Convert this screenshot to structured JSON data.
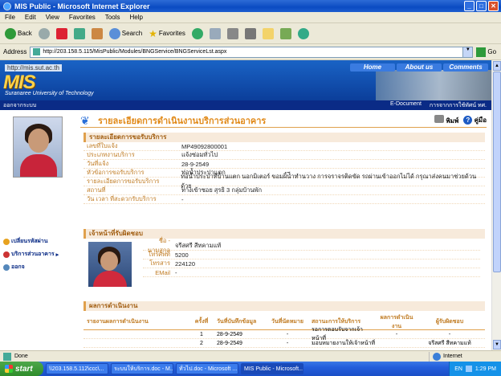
{
  "window": {
    "title": "MIS Public - Microsoft Internet Explorer"
  },
  "menu": [
    "File",
    "Edit",
    "View",
    "Favorites",
    "Tools",
    "Help"
  ],
  "toolbar": {
    "back": "Back",
    "search": "Search",
    "favorites": "Favorites"
  },
  "address": {
    "label": "Address",
    "url": "http://203.158.5.115/MisPublic/Modules/BNGService/BNGServiceLst.aspx",
    "go": "Go"
  },
  "header": {
    "site_url": "http://mis.sut.ac.th",
    "logo": "MIS",
    "subtitle": "Suranaree University of Technology",
    "nav": [
      "Home",
      "About us",
      "Comments"
    ],
    "left_link": "ออกจากระบบ",
    "right_links": [
      "E-Document",
      "การจากการใช้ทัศน์ ทศ."
    ]
  },
  "sidebar": {
    "items": [
      {
        "label": "เปลี่ยนรหัสผ่าน"
      },
      {
        "label": "บริการส่วนอาคาร"
      },
      {
        "label": "ออกจ"
      }
    ]
  },
  "page": {
    "title": "รายละเอียดการดำเนินงานบริการส่วนอาคาร",
    "print": "พิมพ์",
    "help": "คู่มือ"
  },
  "request": {
    "header": "รายละเอียดการขอรับบริการ",
    "rows": [
      {
        "k": "เลขที่ใบแจ้ง",
        "v": "MP49092800001"
      },
      {
        "k": "ประเภทงานบริการ",
        "v": "แจ้งซ่อมทั่วไป"
      },
      {
        "k": "วันที่แจ้ง",
        "v": "28-9-2549"
      },
      {
        "k": "หัวข้อการขอรับบริการ",
        "v": "ท่อน้ำประปาแตก"
      },
      {
        "k": "รายละเอียดการขอรับบริการ",
        "v": "ท่อน้ำประปาที่บ้านแตก นอกมิเตอร์ ขอมผิ้นีำทำนวาง การจราจรติดขัด รถผ่านเข้าออกไม่ได้ กรุณาส่งคนมาช่วยด้วนด้วย"
      },
      {
        "k": "สถานที่",
        "v": "ทางเข้าซอย สุรธิ 3 กลุ่มบ้านพัก"
      },
      {
        "k": "วัน เวลา ที่สะดวกรับบริการ",
        "v": "-"
      }
    ]
  },
  "officer": {
    "header": "เจ้าหน้าที่รับผิดชอบ",
    "rows": [
      {
        "k": "ชื่อ - นามสกุล",
        "v": "จรีสศรี สีทคามแท้"
      },
      {
        "k": "โทรศัพท์",
        "v": "5200"
      },
      {
        "k": "โทรสาร",
        "v": "224120"
      },
      {
        "k": "EMail",
        "v": "-"
      }
    ]
  },
  "progress": {
    "header": "ผลการดำเนินงาน",
    "label": "รายงานผลการดำเนินงาน",
    "columns": [
      "ครั้งที่",
      "วันที่บันทึกข้อมูล",
      "วันที่นัดหมาย",
      "สถานะการให้บริการ",
      "ผลการดำเนินงาน",
      "ผู้รับผิดชอบ"
    ],
    "rows": [
      {
        "no": "1",
        "date": "28-9-2549",
        "appt": "-",
        "status": "รอการตอบรับจากเจ้าหน้าที่",
        "result": "-",
        "owner": "-"
      },
      {
        "no": "2",
        "date": "28-9-2549",
        "appt": "-",
        "status": "มอบหมายงานให้เจ้าหน้าที่",
        "result": "",
        "owner": "จรีสศรี สีทคามแท้"
      }
    ]
  },
  "statusbar": {
    "text": "Done",
    "zone": "Internet"
  },
  "taskbar": {
    "start": "start",
    "tasks": [
      "\\\\203.158.5.112\\ccc\\...",
      "ระบบให้บริการ.doc - M...",
      "ทั่วไป.doc - Microsoft ...",
      "MIS Public - Microsoft..."
    ],
    "lang": "EN",
    "clock": "1:29 PM"
  }
}
